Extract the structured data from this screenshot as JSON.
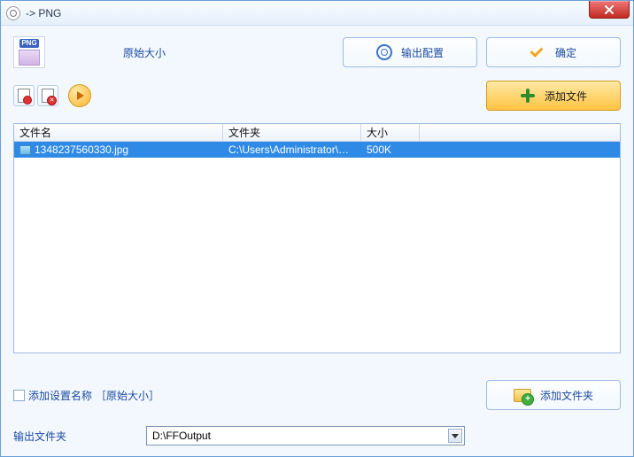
{
  "titlebar": {
    "title": " -> PNG"
  },
  "top": {
    "png_tag": "PNG",
    "original_size_label": "原始大小",
    "output_config_label": "输出配置",
    "ok_label": "确定",
    "add_file_label": "添加文件"
  },
  "table": {
    "headers": {
      "name": "文件名",
      "folder": "文件夹",
      "size": "大小"
    },
    "rows": [
      {
        "name": "1348237560330.jpg",
        "folder": "C:\\Users\\Administrator\\Des...",
        "size": "500K",
        "selected": true
      }
    ]
  },
  "bottom": {
    "checkbox_label": "添加设置名称",
    "checkbox_suffix": "［原始大小］",
    "add_folder_label": "添加文件夹",
    "output_folder_label": "输出文件夹",
    "output_folder_value": "D:\\FFOutput"
  }
}
